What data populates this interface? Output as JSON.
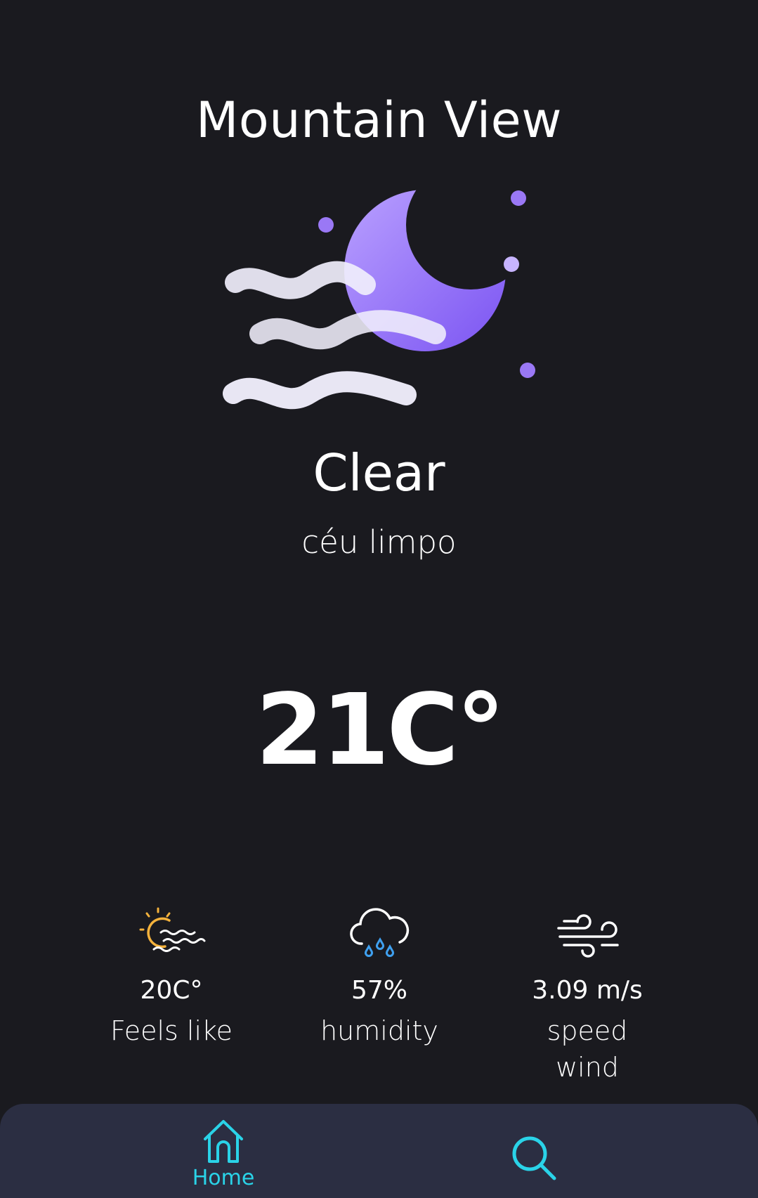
{
  "city": "Mountain View",
  "weather": {
    "condition": "Clear",
    "description": "céu limpo",
    "temperature": "21C°",
    "icon": "moon-fog-icon"
  },
  "stats": [
    {
      "icon": "sun-fog-icon",
      "value": "20C°",
      "label": "Feels like"
    },
    {
      "icon": "rain-cloud-icon",
      "value": "57%",
      "label": "humidity"
    },
    {
      "icon": "wind-icon",
      "value": "3.09 m/s",
      "label": "speed\nwind"
    }
  ],
  "tabbar": {
    "home_label": "Home",
    "home_icon": "home-icon",
    "search_icon": "search-icon"
  },
  "colors": {
    "background": "#1a1a1f",
    "tabbar": "#2b2e42",
    "accent": "#2ad3e8",
    "moon": "#8f6cf5",
    "sun": "#f4b23c",
    "rain": "#3fa0ef"
  }
}
